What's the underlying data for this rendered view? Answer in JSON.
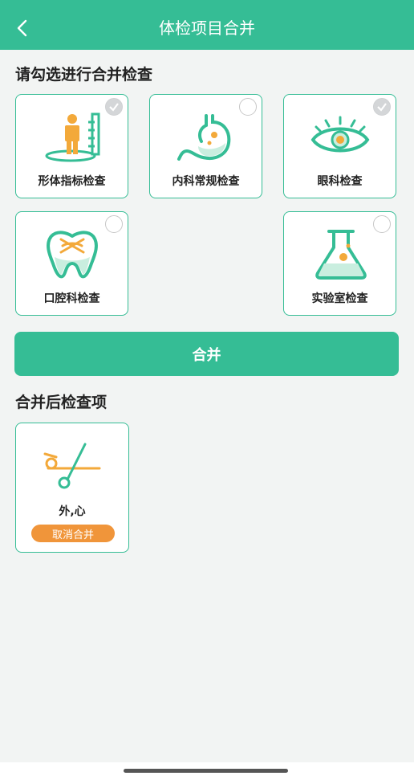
{
  "header": {
    "title": "体检项目合并"
  },
  "select_section": {
    "title": "请勾选进行合并检查"
  },
  "items": [
    {
      "label": "形体指标检查",
      "checked": true
    },
    {
      "label": "内科常规检查",
      "checked": false
    },
    {
      "label": "眼科检查",
      "checked": true
    },
    {
      "label": "口腔科检查",
      "checked": false
    },
    {
      "label": "实验室检查",
      "checked": false
    }
  ],
  "merge_button": {
    "label": "合并"
  },
  "result_section": {
    "title": "合并后检查项",
    "items": [
      {
        "label": "外,心",
        "cancel_label": "取消合并"
      }
    ]
  },
  "colors": {
    "accent": "#35bd95",
    "cancel": "#f0953a",
    "icon_orange": "#f3a93a"
  }
}
